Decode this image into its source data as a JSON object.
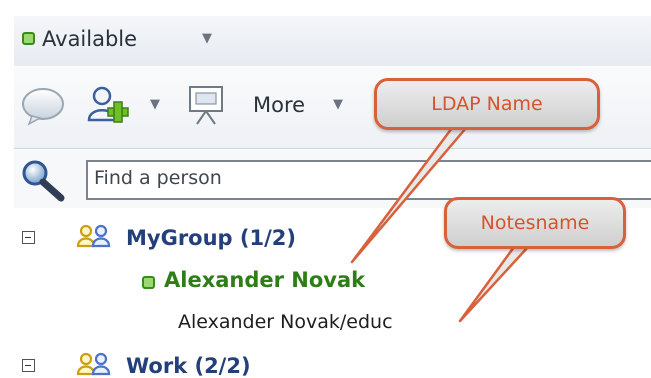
{
  "status": {
    "label": "Available",
    "caret_icon": "caret-down-icon",
    "status_color": "#9bd86f"
  },
  "toolbar": {
    "chat_icon": "chat-bubble-icon",
    "add_contact_icon": "add-contact-icon",
    "present_icon": "presentation-icon",
    "more_label": "More"
  },
  "search": {
    "icon": "magnifier-icon",
    "placeholder": "Find a person"
  },
  "tree": {
    "groups": [
      {
        "label": "MyGroup (1/2)"
      },
      {
        "label": "Work (2/2)"
      }
    ],
    "person": {
      "display_name": "Alexander Novak",
      "notes_name": "Alexander Novak/educ",
      "status_color": "#9bd86f",
      "name_color": "#2e7d16"
    }
  },
  "callouts": {
    "ldap_label": "LDAP Name",
    "notes_label": "Notesname",
    "accent": "#d8613b"
  }
}
